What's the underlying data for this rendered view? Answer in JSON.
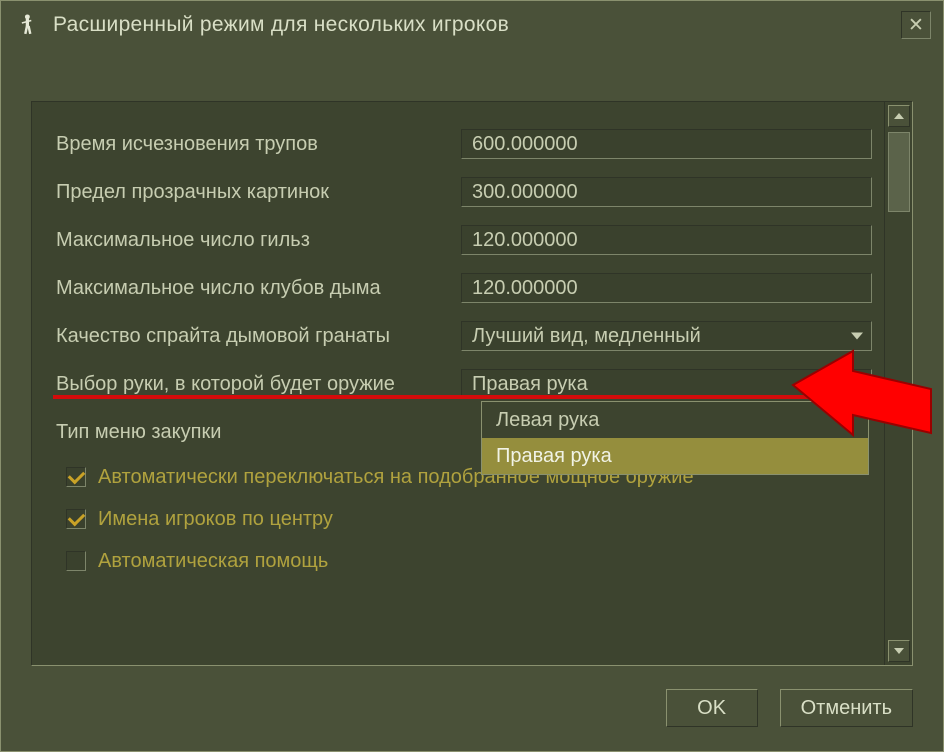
{
  "window": {
    "title": "Расширенный режим для нескольких игроков"
  },
  "rows": [
    {
      "label": "Время исчезновения трупов",
      "value": "600.000000",
      "type": "text"
    },
    {
      "label": "Предел прозрачных картинок",
      "value": "300.000000",
      "type": "text"
    },
    {
      "label": "Максимальное число гильз",
      "value": "120.000000",
      "type": "text"
    },
    {
      "label": "Максимальное число клубов дыма",
      "value": "120.000000",
      "type": "text"
    },
    {
      "label": "Качество спрайта дымовой гранаты",
      "value": "Лучший вид, медленный",
      "type": "dropdown"
    },
    {
      "label": "Выбор руки, в которой будет оружие",
      "value": "Правая рука",
      "type": "dropdown"
    },
    {
      "label": "Тип меню закупки",
      "value": "",
      "type": "plain"
    }
  ],
  "dropdown_options": {
    "hand": [
      "Левая рука",
      "Правая рука"
    ]
  },
  "checkboxes": [
    {
      "label": "Автоматически переключаться на подобранное мощное оружие",
      "checked": true
    },
    {
      "label": "Имена игроков по центру",
      "checked": true
    },
    {
      "label": "Автоматическая помощь",
      "checked": false
    }
  ],
  "buttons": {
    "ok": "OK",
    "cancel": "Отменить"
  }
}
